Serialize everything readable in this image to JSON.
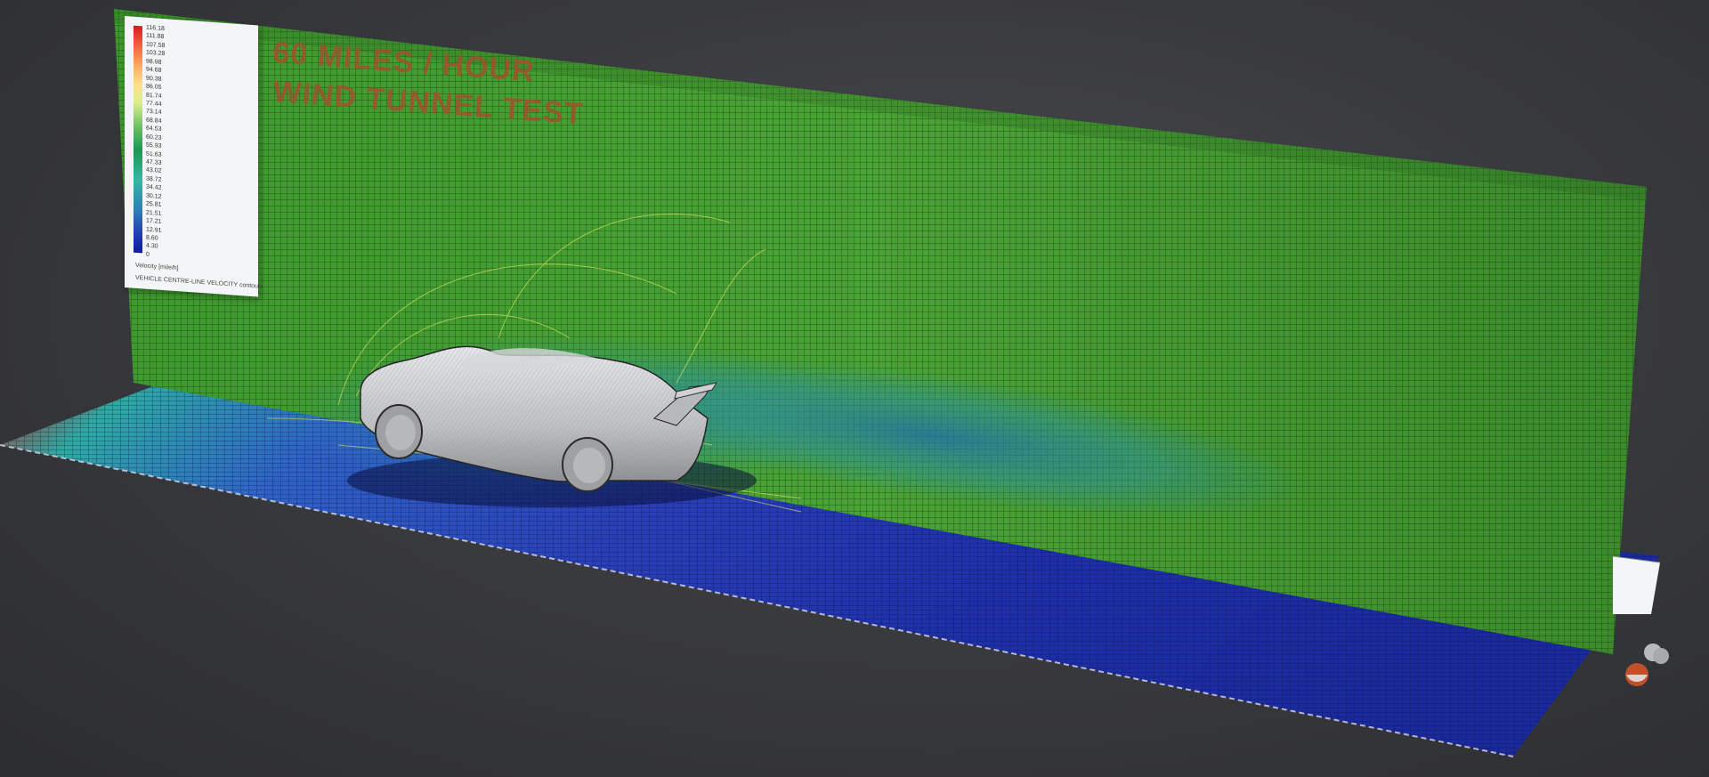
{
  "scene": {
    "title_line1": "60 MILES / HOUR",
    "title_line2": "WIND TUNNEL TEST"
  },
  "legend": {
    "ticks": [
      "116.18",
      "111.88",
      "107.58",
      "103.28",
      "98.98",
      "94.68",
      "90.38",
      "86.05",
      "81.74",
      "77.44",
      "73.14",
      "68.84",
      "64.53",
      "60.23",
      "55.93",
      "51.63",
      "47.33",
      "43.02",
      "38.72",
      "34.42",
      "30.12",
      "25.81",
      "21.51",
      "17.21",
      "12.91",
      "8.60",
      "4.30",
      "0"
    ],
    "unit": "Velocity [mile/h]",
    "caption": "VEHICLE CENTRE-LINE VELOCITY contours",
    "colors": [
      "#d7191c",
      "#fdae61",
      "#fee08b",
      "#66bd63",
      "#1a9850",
      "#35b7a5",
      "#2c7bb6",
      "#0f1a9e"
    ]
  },
  "colors": {
    "background": "#34353a",
    "vertical_plane": "#3f8f2e",
    "floor_plane_low": "#1a2fa0",
    "floor_plane_high": "#c0302a",
    "car_body": "#c9cacc",
    "title_text": "#a0522d"
  }
}
